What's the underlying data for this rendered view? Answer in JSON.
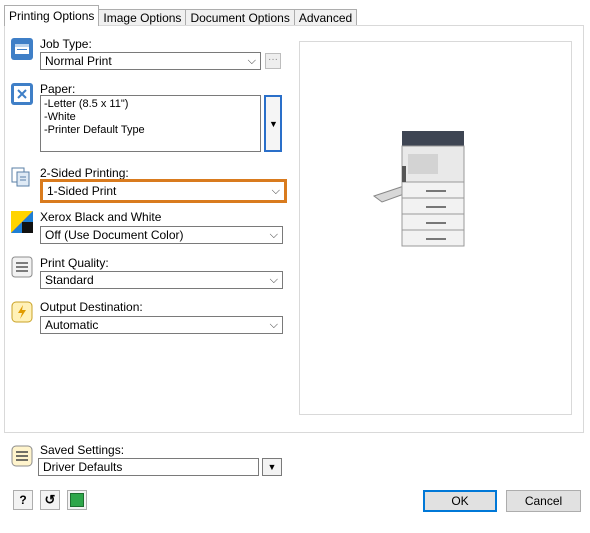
{
  "tabs": [
    "Printing Options",
    "Image Options",
    "Document Options",
    "Advanced"
  ],
  "job_type": {
    "label": "Job Type:",
    "value": "Normal Print",
    "more_button": "···"
  },
  "paper": {
    "label": "Paper:",
    "lines": [
      "-Letter (8.5 x 11\")",
      "-White",
      "-Printer Default Type"
    ]
  },
  "two_sided": {
    "label": "2-Sided Printing:",
    "value": "1-Sided Print"
  },
  "color_mode": {
    "label": "Xerox Black and White",
    "value": "Off (Use Document Color)"
  },
  "print_quality": {
    "label": "Print Quality:",
    "value": "Standard"
  },
  "output_destination": {
    "label": "Output Destination:",
    "value": "Automatic"
  },
  "saved_settings": {
    "label": "Saved Settings:",
    "value": "Driver Defaults"
  },
  "footer": {
    "help_label": "?",
    "ok_label": "OK",
    "cancel_label": "Cancel"
  },
  "colors": {
    "highlight": "#d97b1e",
    "default_button": "#0078d7"
  }
}
